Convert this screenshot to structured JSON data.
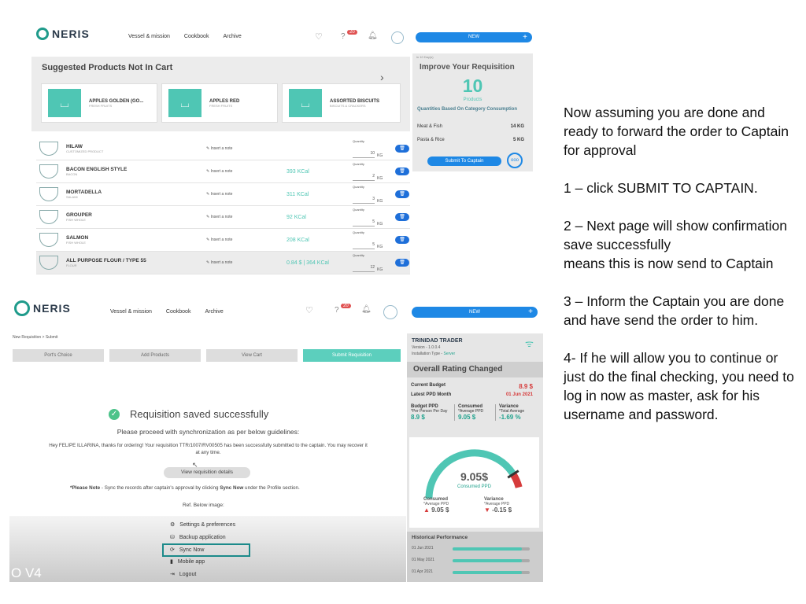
{
  "top": {
    "logo_text": "NERIS",
    "nav": [
      "Vessel & mission",
      "Cookbook",
      "Archive"
    ],
    "badge": "20",
    "new_label": "NEW",
    "plus": "+",
    "suggested_title": "Suggested Products Not In Cart",
    "suggested": [
      {
        "name": "APPLES GOLDEN (GO...",
        "cat": "FRESH FRUITS"
      },
      {
        "name": "APPLES RED",
        "cat": "FRESH FRUITS"
      },
      {
        "name": "ASSORTED BISCUITS",
        "cat": "BISCUITS & CRACKERS"
      }
    ],
    "improve": {
      "cut_label": "in 10 Day(s)",
      "title": "Improve Your Requisition",
      "count": "10",
      "count_label": "Products",
      "subtitle": "Quantities Based On Category Consumption",
      "items": [
        {
          "label": "Meat & Fish",
          "value": "14 KG"
        },
        {
          "label": "Pasta & Rice",
          "value": "5 KG"
        }
      ],
      "submit_label": "Submit To Captain",
      "more": "ooo"
    },
    "note_label": "Insert a note",
    "qty_label": "Quantity",
    "rows": [
      {
        "name": "HILAW",
        "sub": "CUSTOMIZED PRODUCT",
        "kcal": "",
        "qty": "10",
        "unit": "KG"
      },
      {
        "name": "BACON ENGLISH STYLE",
        "sub": "BACON",
        "kcal": "393 KCal",
        "qty": "2",
        "unit": "KG"
      },
      {
        "name": "MORTADELLA",
        "sub": "SALAMI",
        "kcal": "311 KCal",
        "qty": "3",
        "unit": "KG"
      },
      {
        "name": "GROUPER",
        "sub": "FISH WHOLE",
        "kcal": "92 KCal",
        "qty": "5",
        "unit": "KG"
      },
      {
        "name": "SALMON",
        "sub": "FISH WHOLE",
        "kcal": "208 KCal",
        "qty": "5",
        "unit": "KG"
      },
      {
        "name": "ALL PURPOSE FLOUR / TYPE 55",
        "sub": "FLOUR",
        "kcal": "0.84 $ | 364 KCal",
        "qty": "12",
        "unit": "KG"
      }
    ]
  },
  "bottom": {
    "logo_text": "NERIS",
    "nav": [
      "Vessel & mission",
      "Cookbook",
      "Archive"
    ],
    "badge": "20",
    "new_label": "NEW",
    "plus": "+",
    "breadcrumb": "New Requisition  >  Submit",
    "tabs": [
      "Port's Choice",
      "Add Products",
      "View Cart",
      "Submit Requisition"
    ],
    "saved_title": "Requisition saved successfully",
    "proceed": "Please proceed with synchronization as per below guidelines:",
    "thanks": "Hey FELIPE ILLARINA, thanks for ordering! Your requisition TTR/1007/RV00505 has been successfully submitted to the captain. You may recover it at any time.",
    "view_details": "View requisition details",
    "please_note_bold": "*Please Note",
    "please_note": " - Sync the records after captain's approval by clicking ",
    "sync_bold": "Sync Now",
    "please_note_end": " under the Profile section.",
    "ref": "Ref. Below image:",
    "menu": [
      "Settings & preferences",
      "Backup application",
      "Sync Now",
      "Mobile app",
      "Logout"
    ],
    "watermark": "O V4",
    "side": {
      "vessel": "TRINIDAD TRADER",
      "version": "Version - 1.0.0.4",
      "install_label": "Installation Type - ",
      "install_value": "Server",
      "rating_title": "Overall Rating Changed",
      "current_budget_label": "Current Budget",
      "current_budget": "8.9 $",
      "ppd_month_label": "Latest PPD Month",
      "ppd_month": "01 Jun 2021",
      "budget_ppd_label": "Budget PPD",
      "budget_ppd_sub": "*Per Person Per Day",
      "budget_ppd": "8.9 $",
      "consumed_label": "Consumed",
      "consumed_sub": "*Average PPD",
      "consumed": "9.05 $",
      "variance_label": "Variance",
      "variance_sub": "*Total Average",
      "variance": "-1.69 %",
      "gauge_value": "9.05$",
      "gauge_label": "Consumed PPD",
      "gauge_fill": 0.82,
      "c2_label": "Consumed",
      "c2_sub": "*Average PPD",
      "c2_value": "9.05 $",
      "v2_label": "Variance",
      "v2_sub": "*Average PPD",
      "v2_value": "-0.15 $",
      "hist_title": "Historical Performance",
      "hist": [
        {
          "month": "01 Jun 2021",
          "level": 0.9
        },
        {
          "month": "01 May 2021",
          "level": 0.9
        },
        {
          "month": "01 Apr 2021",
          "level": 0.9
        }
      ]
    }
  },
  "notes": {
    "intro": "Now assuming you are done and ready to forward the order to Captain for approval",
    "step1": "1 – click SUBMIT TO CAPTAIN.",
    "step2a": "2 – Next page will show confirmation save successfully",
    "step2b": " means this is now send to Captain",
    "step3": "3 – Inform the Captain you are done and have send the order to him.",
    "step4": "4- If he will allow you to continue or just do the final checking, you need to log in now as master, ask for his username and password."
  },
  "colors": {
    "teal": "#4fc6b4",
    "blue": "#1e88e5",
    "red": "#d63b3b"
  }
}
